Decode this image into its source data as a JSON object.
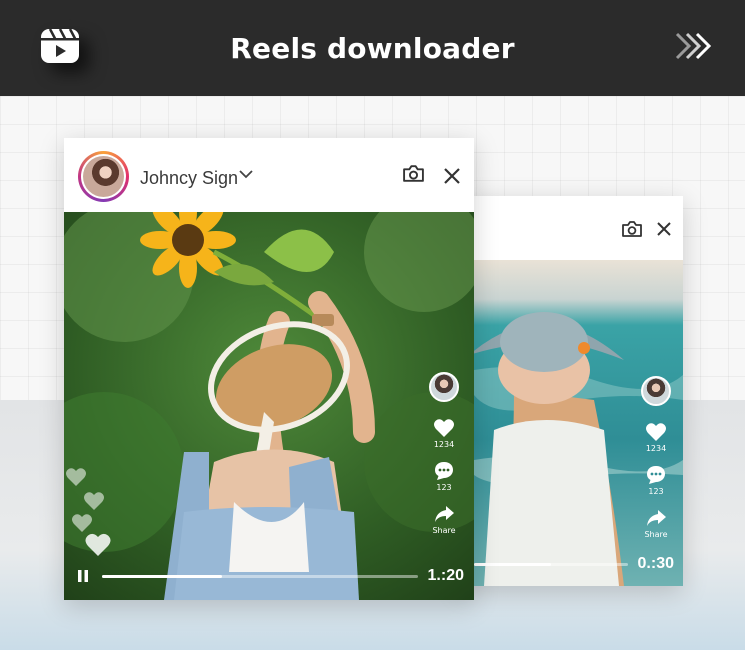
{
  "header": {
    "title": "Reels downloader",
    "app_icon": "reels-icon",
    "next_icon": "double-chevron-right-icon",
    "background": "#2b2b2b"
  },
  "front_card": {
    "username": "Johncy Sign",
    "actions": {
      "likes": "1234",
      "comments": "123",
      "share": "Share"
    },
    "player": {
      "time": "1.:20",
      "progress": 0.38
    }
  },
  "back_card": {
    "actions": {
      "likes": "1234",
      "comments": "123",
      "share": "Share"
    },
    "player": {
      "time": "0.:30",
      "progress": 0.5
    }
  }
}
